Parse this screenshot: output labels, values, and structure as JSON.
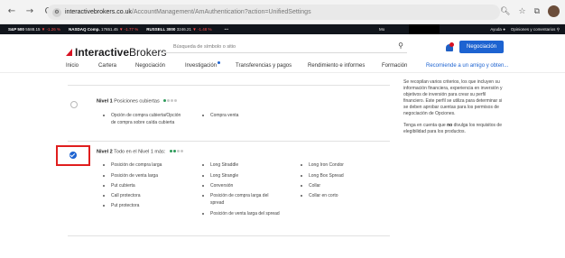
{
  "browser": {
    "back": "←",
    "forward": "→",
    "reload": "C",
    "site_icon": "⚙",
    "url_host": "interactivebrokers.co.uk",
    "url_path": "/AccountManagement/AmAuthentication?action=UnifiedSettings",
    "zoom_icon": "search-icon",
    "star": "☆",
    "ext": "⧉"
  },
  "ticker": {
    "items": [
      {
        "name": "S&P 500",
        "value": "5588.15",
        "change": "▼ -1.26 %"
      },
      {
        "name": "NASDAQ Comp.",
        "value": "17651.45",
        "change": "▼ -1.77 %"
      },
      {
        "name": "RUSSELL 3000",
        "value": "3246.21",
        "change": "▼ -1.48 %"
      }
    ],
    "more": "•••",
    "masked_label": "Mo",
    "help": "Ayuda",
    "options": "Opiniones y comentarios"
  },
  "header": {
    "logo_bold": "Interactive",
    "logo_rest": "Brokers",
    "search_placeholder": "Búsqueda de símbolo o sitio",
    "cta": "Negociación"
  },
  "nav": {
    "items": [
      "Inicio",
      "Cartera",
      "Negociación",
      "Investigación",
      "Transferencias y pagos",
      "Rendimiento e informes",
      "Formación",
      "Recomiende a un amigo y obten..."
    ]
  },
  "levels": [
    {
      "title": "Nivel 1",
      "desc": "Posiciones cubiertas",
      "dots_on": 1,
      "dots_total": 4,
      "checked": false,
      "bullets": [
        "Opción de compra cubierta/Opción de compra sobre caída cubierta",
        "Compra venta"
      ]
    },
    {
      "title": "Nivel 2",
      "desc": "Todo en el Nivel 1 más:",
      "dots_on": 2,
      "dots_total": 4,
      "checked": true,
      "bullets": [
        "Posición de compra larga",
        "Posición de venta larga",
        "Put cubierta",
        "Call protectora",
        "Put protectora",
        "Long Straddle",
        "Long Strangle",
        "Conversión",
        "Posición de compra larga del spread",
        "Posición de venta larga del spread",
        "Long Iron Condor",
        "Long Box Spread",
        "Collar",
        "Collar en corto"
      ]
    }
  ],
  "sidebar": {
    "p1": "Se recopilan varios criterios, los que incluyen su información financiera, experiencia en inversión y objetivos de inversión para crear su perfil financiero. Este perfil se utiliza para determinar si se deben aprobar cuentas para los permisos de negociación de Opciones.",
    "p2_pre": "Tenga en cuenta que",
    "p2_bold": "no",
    "p2_post": "divulga los requisitos de elegibilidad para los productos."
  },
  "colors": {
    "brand_red": "#d81222",
    "accent_blue": "#1d63d1",
    "level_dot_on": "#2e9b5b",
    "highlight_box": "#e01e1e"
  }
}
